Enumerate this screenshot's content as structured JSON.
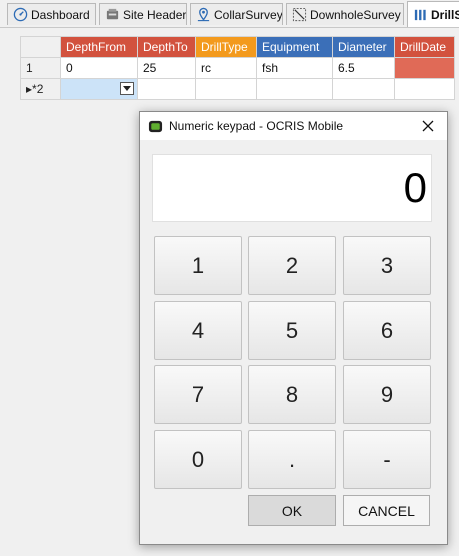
{
  "tabs": [
    {
      "label": "Dashboard",
      "icon": "dashboard-icon"
    },
    {
      "label": "Site Header",
      "icon": "site-header-icon"
    },
    {
      "label": "CollarSurvey",
      "icon": "collar-survey-icon"
    },
    {
      "label": "DownholeSurvey",
      "icon": "downhole-survey-icon"
    },
    {
      "label": "DrillS",
      "icon": "drill-icon",
      "active": true
    }
  ],
  "grid": {
    "columns": [
      {
        "label": "DepthFrom",
        "color": "#d2523e"
      },
      {
        "label": "DepthTo",
        "color": "#d2523e"
      },
      {
        "label": "DrillType",
        "color": "#f39a1d"
      },
      {
        "label": "Equipment",
        "color": "#3b6fb8"
      },
      {
        "label": "Diameter",
        "color": "#3b6fb8"
      },
      {
        "label": "DrillDate",
        "color": "#d2523e"
      }
    ],
    "rows": [
      {
        "header": "1",
        "cells": [
          "0",
          "25",
          "rc",
          "fsh",
          "6.5",
          ""
        ]
      },
      {
        "header": "▸*2",
        "cells": [
          "",
          "",
          "",
          "",
          "",
          ""
        ]
      }
    ]
  },
  "dialog": {
    "title": "Numeric keypad - OCRIS Mobile",
    "display_value": "0",
    "keys": [
      "1",
      "2",
      "3",
      "4",
      "5",
      "6",
      "7",
      "8",
      "9",
      "0",
      ".",
      "-"
    ],
    "ok_label": "OK",
    "cancel_label": "CANCEL"
  },
  "colors": {
    "header_red": "#d2523e",
    "header_orange": "#f39a1d",
    "header_blue": "#3b6fb8",
    "selected_cell": "#cce3f8",
    "drilldate_cell": "#e06a57"
  }
}
